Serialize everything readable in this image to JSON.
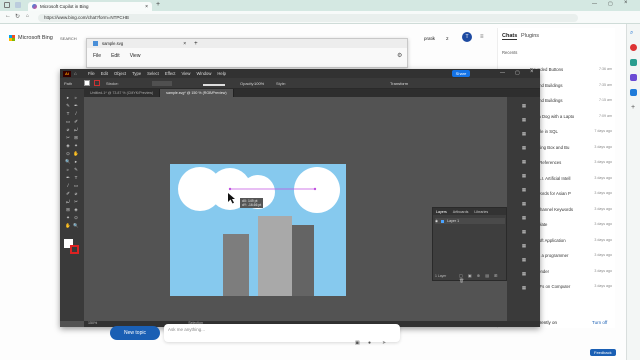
{
  "browser": {
    "tab_title": "Microsoft Copilot in Bing",
    "url": "https://www.bing.com/chat?form=NTPCHB"
  },
  "bing": {
    "brand": "Microsoft Bing",
    "search": "SEARCH",
    "user": "pratik",
    "score": "2",
    "tabs": [
      "Chats",
      "Plugins"
    ],
    "recents_label": "Recents",
    "recents": [
      {
        "title": "Rounded Buttons",
        "time": "7:36 am"
      },
      {
        "title": "ids and Buildings",
        "time": "7:35 am"
      },
      {
        "title": "ids and Buildings",
        "time": "7:15 am"
      },
      {
        "title": "e of a Dog with a Lapto",
        "time": "7:09 am"
      },
      {
        "title": "y Table in SQL",
        "time": "7 days ago"
      },
      {
        "title": "Rotating Box and Bu",
        "time": "3 days ago"
      },
      {
        "title": "Film References",
        "time": "3 days ago"
      },
      {
        "title": "for \"A.I. Artificial Intell",
        "time": "3 days ago"
      },
      {
        "title": "Keywords for Asian P",
        "time": "3 days ago"
      },
      {
        "title": "ing Channel Keywords",
        "time": "3 days ago"
      },
      {
        "title": "Template",
        "time": "3 days ago"
      },
      {
        "title": "ticasoft Application",
        "time": "3 days ago"
      },
      {
        "title": "ay as a programmer",
        "time": "3 days ago"
      },
      {
        "title": "th Gender",
        "time": "3 days ago"
      },
      {
        "title": "e PDFs on Computer",
        "time": "3 days ago"
      }
    ],
    "see_all": "ll",
    "history_text": "s currently on",
    "turn_off": "Turn off",
    "new_topic": "New topic",
    "ask_placeholder": "Ask me anything...",
    "feedback": "Feedback"
  },
  "notepad": {
    "title": "sample.svg",
    "menus": [
      "File",
      "Edit",
      "View"
    ]
  },
  "illustrator": {
    "logo": "Ai",
    "menus": [
      "File",
      "Edit",
      "Object",
      "Type",
      "Select",
      "Effect",
      "View",
      "Window",
      "Help"
    ],
    "share": "Share",
    "ctrl": {
      "mode": "Path",
      "stroke_label": "Stroke:",
      "opacity_label": "Opacity:",
      "opacity": "100%",
      "style_label": "Style:",
      "transform": "Transform"
    },
    "doc_tabs": [
      "Untitled-1* @ 73.87 % (CMYK/Preview)",
      "sample.svg* @ 150 % (RGB/Preview)"
    ],
    "zoom": "150%",
    "status_mode": "Selection",
    "tooltip": {
      "dx": "dX: 149 pt",
      "dy": "dY: -16.66 pt"
    },
    "layers": {
      "tabs": [
        "Layers",
        "Artboards",
        "Libraries"
      ],
      "layer_name": "Layer 1",
      "count": "1 Layer"
    }
  },
  "colors": {
    "sky": "#86c9ee",
    "cloud": "#ffffff",
    "b1": "#7d7d7d",
    "b2": "#a9a9a9",
    "b3": "#646464",
    "guide": "#c050e0",
    "ai_bg": "#535353"
  }
}
